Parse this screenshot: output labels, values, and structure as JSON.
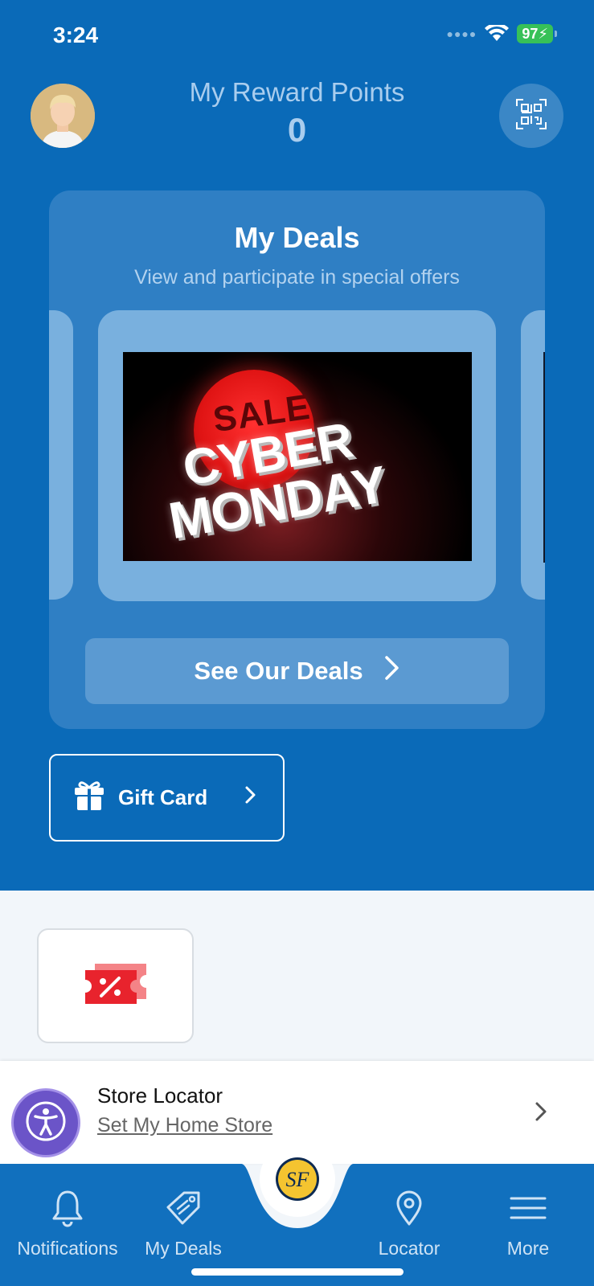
{
  "status_bar": {
    "time": "3:24",
    "battery": "97"
  },
  "header": {
    "reward_title": "My Reward Points",
    "reward_points": "0"
  },
  "deals": {
    "title": "My Deals",
    "subtitle": "View and participate in special offers",
    "promo": {
      "line1": "SALE",
      "line2": "CYBER",
      "line3": "MONDAY"
    },
    "button_label": "See Our Deals"
  },
  "gift_card": {
    "label": "Gift Card"
  },
  "store_locator": {
    "title": "Store Locator",
    "link": "Set My Home Store"
  },
  "bottom_nav": {
    "items": [
      {
        "label": "Notifications",
        "icon": "bell-icon"
      },
      {
        "label": "My Deals",
        "icon": "tag-icon"
      },
      {
        "label": "Locator",
        "icon": "location-pin-icon"
      },
      {
        "label": "More",
        "icon": "menu-icon"
      }
    ],
    "center_logo": "SF"
  },
  "colors": {
    "primary_blue": "#0a6ab8",
    "accent_red": "#e8232d",
    "access_purple": "#6b54c8"
  }
}
